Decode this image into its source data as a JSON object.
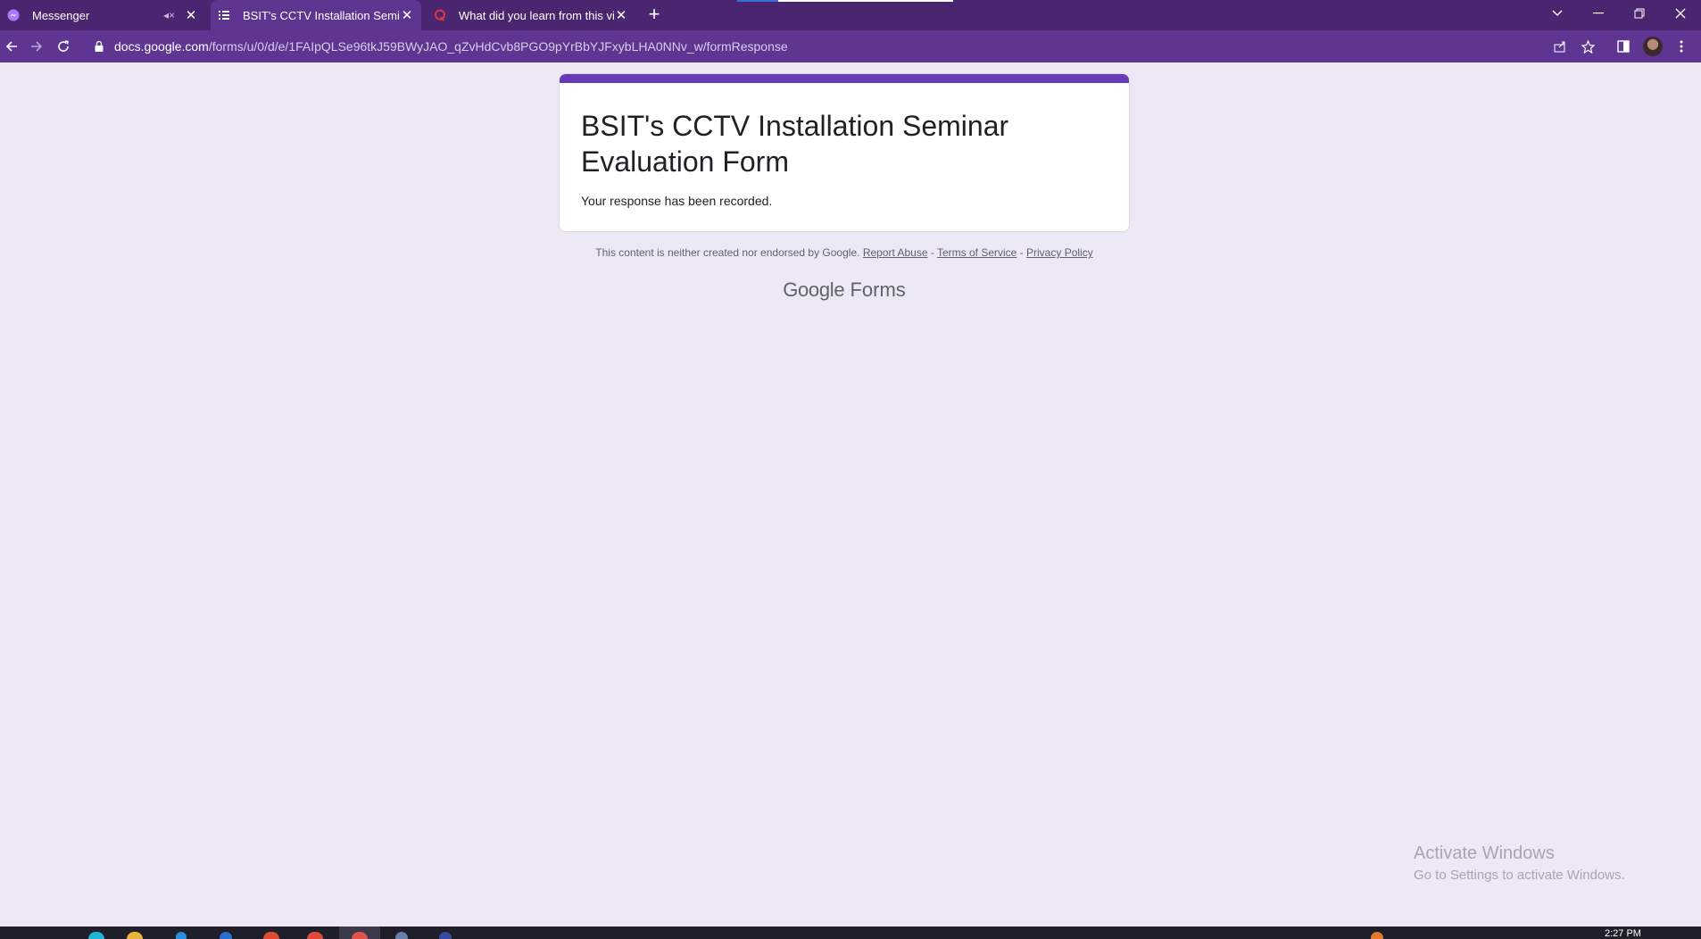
{
  "browser": {
    "tabs": [
      {
        "title": "Messenger",
        "icon": "messenger-icon",
        "muted": true,
        "active": false
      },
      {
        "title": "BSIT's CCTV Installation Seminar",
        "icon": "forms-icon",
        "active": true
      },
      {
        "title": "What did you learn from this vid",
        "icon": "quora-icon",
        "active": false
      }
    ],
    "new_tab_label": "+",
    "url_host": "docs.google.com",
    "url_path": "/forms/u/0/d/e/1FAIpQLSe96tkJ59BWyJAO_qZvHdCvb8PGO9pYrBbYJFxybLHA0NNv_w/formResponse"
  },
  "form": {
    "title": "BSIT's CCTV Installation Seminar Evaluation Form",
    "confirmation": "Your response has been recorded."
  },
  "footer": {
    "disclaimer": "This content is neither created nor endorsed by Google.",
    "report_abuse": "Report Abuse",
    "sep1": " - ",
    "terms": "Terms of Service",
    "sep2": " - ",
    "privacy": "Privacy Policy",
    "brand_google": "Google",
    "brand_forms": "Forms"
  },
  "watermark": {
    "heading": "Activate Windows",
    "sub": "Go to Settings to activate Windows."
  },
  "taskbar": {
    "clock": "2:27 PM"
  },
  "colors": {
    "title_bar": "#4a2670",
    "toolbar": "#5e3691",
    "page_bg": "#ede8f6",
    "form_accent": "#673ab7"
  }
}
